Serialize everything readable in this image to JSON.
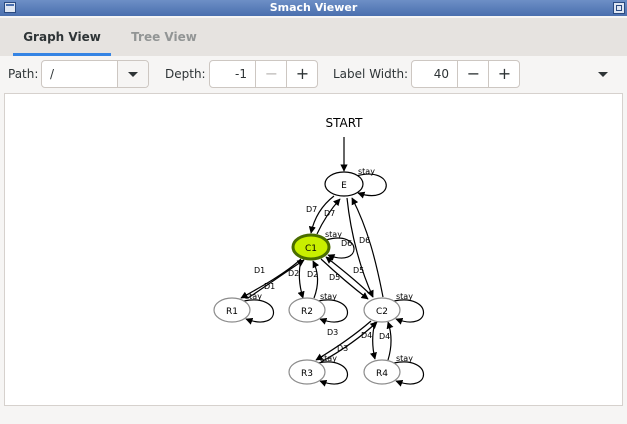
{
  "window": {
    "title": "Smach Viewer"
  },
  "tabs": [
    {
      "label": "Graph View",
      "active": true
    },
    {
      "label": "Tree View",
      "active": false
    }
  ],
  "toolbar": {
    "path_label": "Path:",
    "path_value": "/",
    "depth_label": "Depth:",
    "depth_value": "-1",
    "depth_minus": "−",
    "depth_plus": "+",
    "label_width_label": "Label Width:",
    "label_width_value": "40",
    "label_width_minus": "−",
    "label_width_plus": "+"
  },
  "colors": {
    "accent": "#3584e4",
    "active_state_fill": "#c8ef00",
    "active_state_stroke": "#4a6d00"
  },
  "graph": {
    "start_label": "START",
    "states": [
      {
        "id": "E",
        "active": false
      },
      {
        "id": "C1",
        "active": true
      },
      {
        "id": "R1",
        "active": false
      },
      {
        "id": "R2",
        "active": false
      },
      {
        "id": "C2",
        "active": false
      },
      {
        "id": "R3",
        "active": false
      },
      {
        "id": "R4",
        "active": false
      }
    ],
    "edge_labels": {
      "e_stay": "stay",
      "c1_stay": "stay",
      "r1_stay": "stay",
      "r2_stay": "stay",
      "c2_stay": "stay",
      "r3_stay": "stay",
      "r4_stay": "stay",
      "d7a": "D7",
      "d7b": "D7",
      "d6a": "D6",
      "d6b": "D6",
      "d1a": "D1",
      "d1b": "D1",
      "d2a": "D2",
      "d2b": "D2",
      "d5a": "D5",
      "d5b": "D5",
      "d3a": "D3",
      "d3b": "D3",
      "d4a": "D4",
      "d4b": "D4"
    }
  }
}
